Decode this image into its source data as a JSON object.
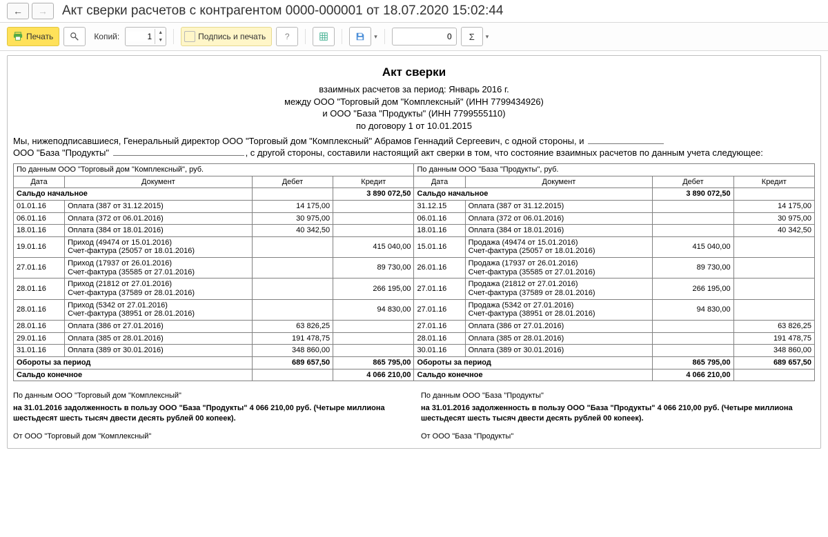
{
  "window": {
    "title": "Акт сверки расчетов с контрагентом 0000-000001 от 18.07.2020 15:02:44"
  },
  "toolbar": {
    "print": "Печать",
    "copies_label": "Копий:",
    "copies_value": "1",
    "signprint": "Подпись и печать",
    "page_value": "0"
  },
  "doc": {
    "title": "Акт сверки",
    "sub1": "взаимных расчетов за период: Январь 2016 г.",
    "sub2": "между ООО \"Торговый дом \"Комплексный\" (ИНН 7799434926)",
    "sub3": "и ООО \"База \"Продукты\" (ИНН 7799555110)",
    "sub4": "по договору 1 от 10.01.2015",
    "preamble_a": "Мы, нижеподписавшиеся, Генеральный директор ООО \"Торговый дом \"Комплексный\" Абрамов Геннадий Сергеевич, с одной стороны, и ",
    "preamble_b": "ООО \"База \"Продукты\" ",
    "preamble_c": ", с другой стороны, составили настоящий акт сверки в том, что состояние взаимных расчетов по данным учета следующее:"
  },
  "table": {
    "party_left": "По данным ООО \"Торговый дом \"Комплексный\", руб.",
    "party_right": "По данным ООО \"База \"Продукты\", руб.",
    "col_date": "Дата",
    "col_doc": "Документ",
    "col_debit": "Дебет",
    "col_credit": "Кредит",
    "opening": "Сальдо начальное",
    "opening_val": "3 890 072,50",
    "turnover": "Обороты за период",
    "closing": "Сальдо конечное",
    "turnover_left_debit": "689 657,50",
    "turnover_left_credit": "865 795,00",
    "turnover_right_debit": "865 795,00",
    "turnover_right_credit": "689 657,50",
    "closing_left": "4 066 210,00",
    "closing_right": "4 066 210,00",
    "rows": [
      {
        "ld": "01.01.16",
        "ldoc": "Оплата (387 от 31.12.2015)",
        "ldeb": "14 175,00",
        "lcred": "",
        "rd": "31.12.15",
        "rdoc": "Оплата (387 от 31.12.2015)",
        "rdeb": "",
        "rcred": "14 175,00"
      },
      {
        "ld": "06.01.16",
        "ldoc": "Оплата (372 от 06.01.2016)",
        "ldeb": "30 975,00",
        "lcred": "",
        "rd": "06.01.16",
        "rdoc": "Оплата (372 от 06.01.2016)",
        "rdeb": "",
        "rcred": "30 975,00"
      },
      {
        "ld": "18.01.16",
        "ldoc": "Оплата (384 от 18.01.2016)",
        "ldeb": "40 342,50",
        "lcred": "",
        "rd": "18.01.16",
        "rdoc": "Оплата (384 от 18.01.2016)",
        "rdeb": "",
        "rcred": "40 342,50"
      },
      {
        "ld": "19.01.16",
        "ldoc": "Приход (49474 от 15.01.2016)\nСчет-фактура (25057 от 18.01.2016)",
        "ldeb": "",
        "lcred": "415 040,00",
        "rd": "15.01.16",
        "rdoc": "Продажа (49474 от 15.01.2016)\nСчет-фактура (25057 от 18.01.2016)",
        "rdeb": "415 040,00",
        "rcred": ""
      },
      {
        "ld": "27.01.16",
        "ldoc": "Приход (17937 от 26.01.2016)\nСчет-фактура (35585 от 27.01.2016)",
        "ldeb": "",
        "lcred": "89 730,00",
        "rd": "26.01.16",
        "rdoc": "Продажа (17937 от 26.01.2016)\nСчет-фактура (35585 от 27.01.2016)",
        "rdeb": "89 730,00",
        "rcred": ""
      },
      {
        "ld": "28.01.16",
        "ldoc": "Приход (21812 от 27.01.2016)\nСчет-фактура (37589 от 28.01.2016)",
        "ldeb": "",
        "lcred": "266 195,00",
        "rd": "27.01.16",
        "rdoc": "Продажа (21812 от 27.01.2016)\nСчет-фактура (37589 от 28.01.2016)",
        "rdeb": "266 195,00",
        "rcred": ""
      },
      {
        "ld": "28.01.16",
        "ldoc": "Приход (5342 от 27.01.2016)\nСчет-фактура (38951 от 28.01.2016)",
        "ldeb": "",
        "lcred": "94 830,00",
        "rd": "27.01.16",
        "rdoc": "Продажа (5342 от 27.01.2016)\nСчет-фактура (38951 от 28.01.2016)",
        "rdeb": "94 830,00",
        "rcred": ""
      },
      {
        "ld": "28.01.16",
        "ldoc": "Оплата (386 от 27.01.2016)",
        "ldeb": "63 826,25",
        "lcred": "",
        "rd": "27.01.16",
        "rdoc": "Оплата (386 от 27.01.2016)",
        "rdeb": "",
        "rcred": "63 826,25"
      },
      {
        "ld": "29.01.16",
        "ldoc": "Оплата (385 от 28.01.2016)",
        "ldeb": "191 478,75",
        "lcred": "",
        "rd": "28.01.16",
        "rdoc": "Оплата (385 от 28.01.2016)",
        "rdeb": "",
        "rcred": "191 478,75"
      },
      {
        "ld": "31.01.16",
        "ldoc": "Оплата (389 от 30.01.2016)",
        "ldeb": "348 860,00",
        "lcred": "",
        "rd": "30.01.16",
        "rdoc": "Оплата (389 от 30.01.2016)",
        "rdeb": "",
        "rcred": "348 860,00"
      }
    ]
  },
  "footer": {
    "left_hdr": "По данным ООО \"Торговый дом \"Комплексный\"",
    "left_strong": "на 31.01.2016 задолженность в пользу ООО \"База \"Продукты\" 4 066 210,00 руб. (Четыре миллиона шестьдесят шесть тысяч двести десять рублей 00 копеек).",
    "left_from": "От ООО \"Торговый дом \"Комплексный\"",
    "right_hdr": "По данным ООО \"База \"Продукты\"",
    "right_strong": "на 31.01.2016 задолженность в пользу ООО \"База \"Продукты\" 4 066 210,00 руб. (Четыре миллиона шестьдесят шесть тысяч двести десять рублей 00 копеек).",
    "right_from": "От ООО \"База \"Продукты\""
  }
}
